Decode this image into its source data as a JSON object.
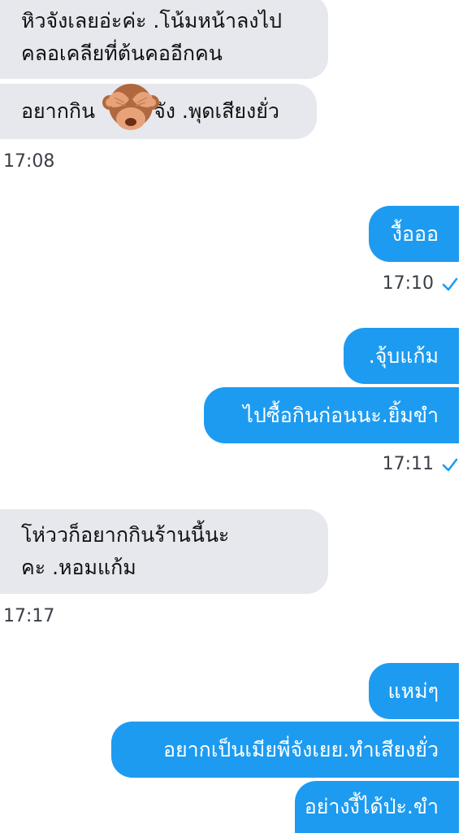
{
  "messages": [
    {
      "id": "m1",
      "direction": "in",
      "lines": [
        "หิวจังเลยอ่ะค่ะ .โน้มหน้าลงไป",
        "คลอเคลียที่ต้นคออีกคน"
      ]
    },
    {
      "id": "m2",
      "direction": "in",
      "lines": [
        "อยากกิน",
        "จัง .พุดเสียงยั่ว"
      ],
      "emoji": "see-no-evil-monkey-icon"
    },
    {
      "id": "t1",
      "type": "timestamp",
      "text": "17:08"
    },
    {
      "id": "m3",
      "direction": "out",
      "lines": [
        "งื้อออ"
      ]
    },
    {
      "id": "t2",
      "type": "timestamp",
      "text": "17:10",
      "status": "sent-check-icon"
    },
    {
      "id": "m4",
      "direction": "out",
      "lines": [
        ".จุ้บแก้ม"
      ]
    },
    {
      "id": "m5",
      "direction": "out",
      "lines": [
        "ไปซื้อกินก่อนนะ.ยิ้มขำ"
      ]
    },
    {
      "id": "t3",
      "type": "timestamp",
      "text": "17:11",
      "status": "sent-check-icon"
    },
    {
      "id": "m6",
      "direction": "in",
      "lines": [
        "โห่ววก็อยากกินร้านนี้นะ",
        "คะ .หอมแก้ม"
      ]
    },
    {
      "id": "t4",
      "type": "timestamp",
      "text": "17:17"
    },
    {
      "id": "m7",
      "direction": "out",
      "lines": [
        "แหม่ๆ"
      ]
    },
    {
      "id": "m8",
      "direction": "out",
      "lines": [
        "อยากเป็นเมียพี่จังเยย.ทำเสียงยั่ว"
      ]
    },
    {
      "id": "m9",
      "direction": "out",
      "lines": [
        "อย่างงี้ได้ป่ะ.ขำ"
      ]
    }
  ],
  "colors": {
    "incoming_bubble": "#e6e8ed",
    "outgoing_bubble": "#1d9bf0",
    "timestamp_text": "#3b4047",
    "check": "#1d9bf0"
  }
}
